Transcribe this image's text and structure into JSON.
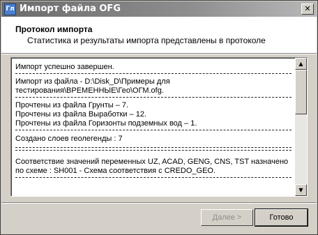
{
  "window": {
    "icon_text": "Гл",
    "title": "Импорт файла OFG",
    "close_glyph": "✕"
  },
  "header": {
    "title": "Протокол импорта",
    "subtitle": "Статистика и результаты импорта представлены в протоколе"
  },
  "log": {
    "lines": [
      "Импорт успешно завершен.",
      "Импорт из файла - D:\\Disk_D\\Примеры для",
      "тестирования\\ВРЕМЕННЫЕ\\Гео\\ОГМ.ofg.",
      "Прочтены из файла Грунты – 7.",
      "Прочтены из файла Выработки – 12.",
      "Прочтены из файла Горизонты подземных вод – 1.",
      "Создано слоев геолегенды : 7",
      "Соответствие значений переменных UZ, ACAD, GENG, CNS, TST назначено",
      "по схеме : SH001 - Схема соответствия с CREDO_GEO."
    ]
  },
  "scrollbar": {
    "up_glyph": "▲",
    "down_glyph": "▼"
  },
  "buttons": {
    "next_label": "Далее >",
    "done_label": "Готово"
  }
}
